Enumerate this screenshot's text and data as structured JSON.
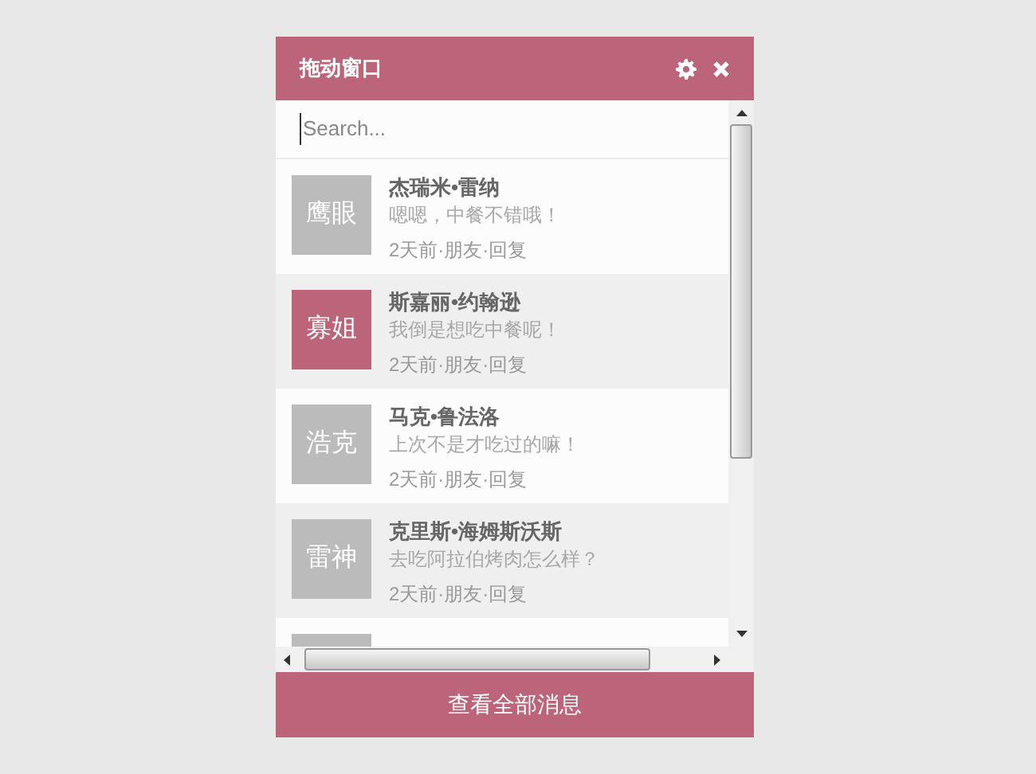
{
  "window": {
    "title": "拖动窗口"
  },
  "search": {
    "placeholder": "Search..."
  },
  "messages": [
    {
      "avatar": "鹰眼",
      "color": "#bbbbbb",
      "name": "杰瑞米•雷纳",
      "text": "嗯嗯，中餐不错哦！",
      "meta": "2天前·朋友·回复"
    },
    {
      "avatar": "寡姐",
      "color": "#bc6479",
      "name": "斯嘉丽•约翰逊",
      "text": "我倒是想吃中餐呢！",
      "meta": "2天前·朋友·回复"
    },
    {
      "avatar": "浩克",
      "color": "#bbbbbb",
      "name": "马克•鲁法洛",
      "text": "上次不是才吃过的嘛！",
      "meta": "2天前·朋友·回复"
    },
    {
      "avatar": "雷神",
      "color": "#bbbbbb",
      "name": "克里斯•海姆斯沃斯",
      "text": "去吃阿拉伯烤肉怎么样？",
      "meta": "2天前·朋友·回复"
    },
    {
      "color": "#bbbbbb"
    }
  ],
  "footer": {
    "button": "查看全部消息"
  }
}
